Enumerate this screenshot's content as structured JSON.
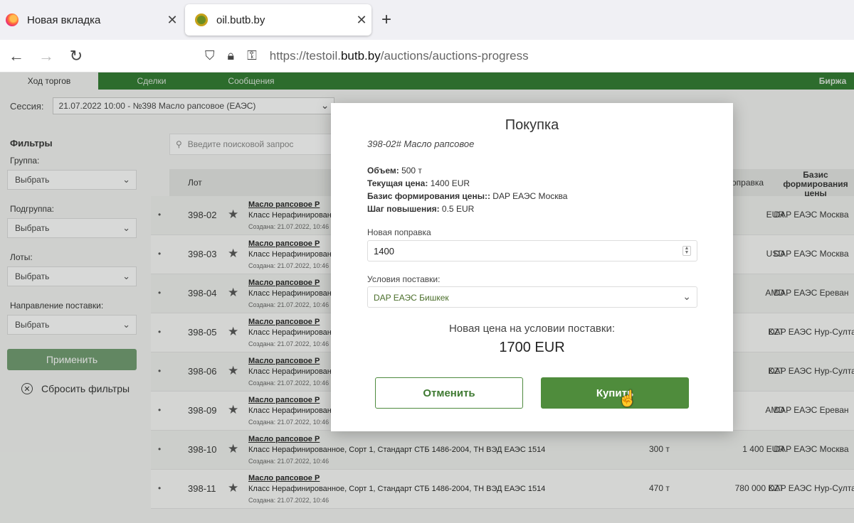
{
  "browser": {
    "tabs": [
      {
        "title": "Новая вкладка",
        "close": "✕"
      },
      {
        "title": "oil.butb.by",
        "close": "✕"
      }
    ],
    "new_tab": "+",
    "url_prefix": "https://testoil.",
    "url_domain": "butb.by",
    "url_path": "/auctions/auctions-progress"
  },
  "page": {
    "tabs": [
      "Ход торгов",
      "Сделки",
      "Сообщения",
      "Биржа"
    ],
    "session_label": "Сессия:",
    "session_value": "21.07.2022 10:00 - №398 Масло рапсовое (ЕАЭС)",
    "filters": {
      "title": "Фильтры",
      "groups": [
        {
          "label": "Группа:",
          "value": "Выбрать"
        },
        {
          "label": "Подгруппа:",
          "value": "Выбрать"
        },
        {
          "label": "Лоты:",
          "value": "Выбрать"
        },
        {
          "label": "Направление поставки:",
          "value": "Выбрать"
        }
      ],
      "apply": "Применить",
      "reset": "Сбросить фильтры"
    },
    "search_placeholder": "Введите поисковой запрос",
    "table": {
      "col_lot": "Лот",
      "col_correction": "оправка",
      "col_basis": "Базис формирования цены",
      "rows": [
        {
          "lot": "398-02",
          "name": "Масло рапсовое Р",
          "desc": "Класс Нерафинированн",
          "created": "Создана: 21.07.2022, 10:46",
          "volume": "",
          "correction": "EUR",
          "basis": "DAP ЕАЭС Москва"
        },
        {
          "lot": "398-03",
          "name": "Масло рапсовое Р",
          "desc": "Класс Нерафинированн",
          "created": "Создана: 21.07.2022, 10:46",
          "volume": "",
          "correction": "USD",
          "basis": "DAP ЕАЭС Москва"
        },
        {
          "lot": "398-04",
          "name": "Масло рапсовое Р",
          "desc": "Класс Нерафинированн",
          "created": "Создана: 21.07.2022, 10:46",
          "volume": "",
          "correction": "AMD",
          "basis": "DAP ЕАЭС Ереван"
        },
        {
          "lot": "398-05",
          "name": "Масло рапсовое Р",
          "desc": "Класс Нерафинированн",
          "created": "Создана: 21.07.2022, 10:46",
          "volume": "",
          "correction": "KZT",
          "basis": "DAP ЕАЭС Нур-Султа"
        },
        {
          "lot": "398-06",
          "name": "Масло рапсовое Р",
          "desc": "Класс Нерафинированн",
          "created": "Создана: 21.07.2022, 10:46",
          "volume": "",
          "correction": "KZT",
          "basis": "DAP ЕАЭС Нур-Султа"
        },
        {
          "lot": "398-09",
          "name": "Масло рапсовое Р",
          "desc": "Класс Нерафинированн",
          "created": "Создана: 21.07.2022, 10:46",
          "volume": "",
          "correction": "AMD",
          "basis": "DAP ЕАЭС Ереван"
        },
        {
          "lot": "398-10",
          "name": "Масло рапсовое Р",
          "desc": "Класс Нерафинированное, Сорт 1, Стандарт СТБ 1486-2004, ТН ВЭД ЕАЭС 1514",
          "created": "Создана: 21.07.2022, 10:46",
          "volume": "300 т",
          "correction": "1 400 EUR",
          "basis": "DAP ЕАЭС Москва"
        },
        {
          "lot": "398-11",
          "name": "Масло рапсовое Р",
          "desc": "Класс Нерафинированное, Сорт 1, Стандарт СТБ 1486-2004, ТН ВЭД ЕАЭС 1514",
          "created": "Создана: 21.07.2022, 10:46",
          "volume": "470 т",
          "correction": "780 000 KZT",
          "basis": "DAP ЕАЭС Нур-Султа"
        }
      ]
    }
  },
  "modal": {
    "title": "Покупка",
    "subtitle": "398-02# Масло рапсовое",
    "volume_label": "Объем:",
    "volume_value": "500 т",
    "price_label": "Текущая цена:",
    "price_value": "1400 EUR",
    "basis_label": "Базис формирования цены::",
    "basis_value": "DAP ЕАЭС Москва",
    "step_label": "Шаг повышения:",
    "step_value": "0.5 EUR",
    "correction_label": "Новая поправка",
    "correction_value": "1400",
    "delivery_label": "Условия поставки:",
    "delivery_value": "DAP ЕАЭС Бишкек",
    "new_price_label": "Новая цена на условии поставки:",
    "new_price_value": "1700 EUR",
    "cancel": "Отменить",
    "buy": "Купить"
  }
}
